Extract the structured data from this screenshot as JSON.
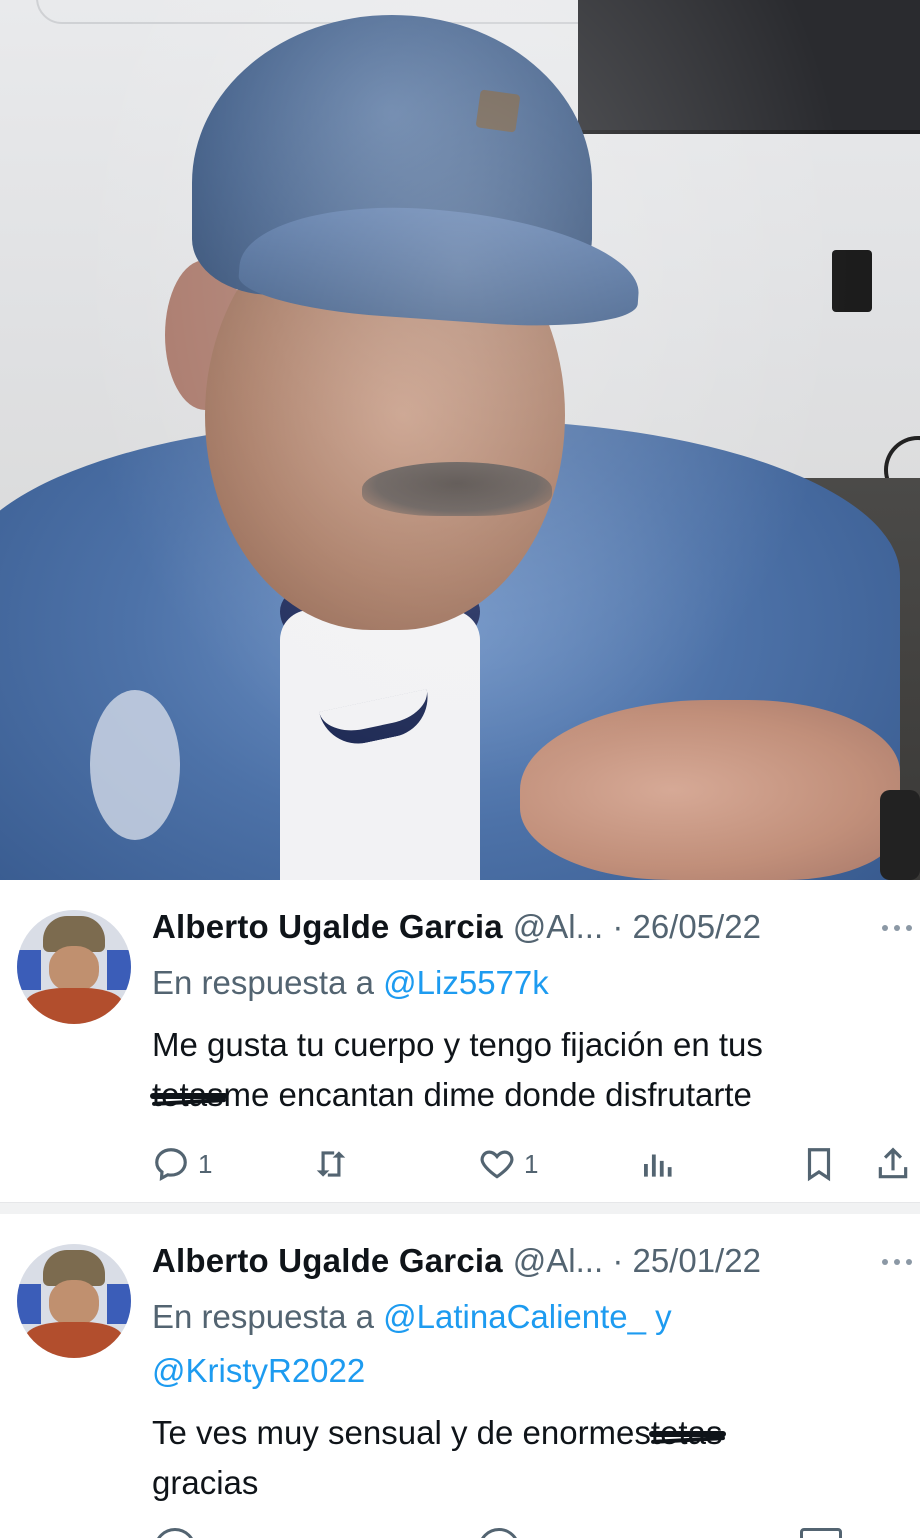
{
  "video": {
    "description_icons": []
  },
  "tweets": [
    {
      "name": "Alberto Ugalde Garcia",
      "handle_date": "@Al... · 26/05/22",
      "reply_prefix": "En respuesta a",
      "reply_handles": "@Liz5577k",
      "body_line1": "Me gusta tu cuerpo y tengo fijación en tus",
      "body_censored1": "tetas",
      "body_line2": "me encantan dime donde disfrutarte",
      "replies": "1",
      "retweets": "",
      "likes": "1"
    },
    {
      "name": "Alberto Ugalde Garcia",
      "handle_date": "@Al... · 25/01/22",
      "reply_prefix": "En respuesta a",
      "reply_handles": "@LatinaCaliente_ y",
      "reply_handles2": "@KristyR2022",
      "body_line1": "Te ves muy sensual y de enormes",
      "body_censored1": "tetas",
      "body_line2": "gracias"
    }
  ],
  "colors": {
    "link": "#1d9bf0",
    "muted": "#536471",
    "text": "#0f1419"
  }
}
